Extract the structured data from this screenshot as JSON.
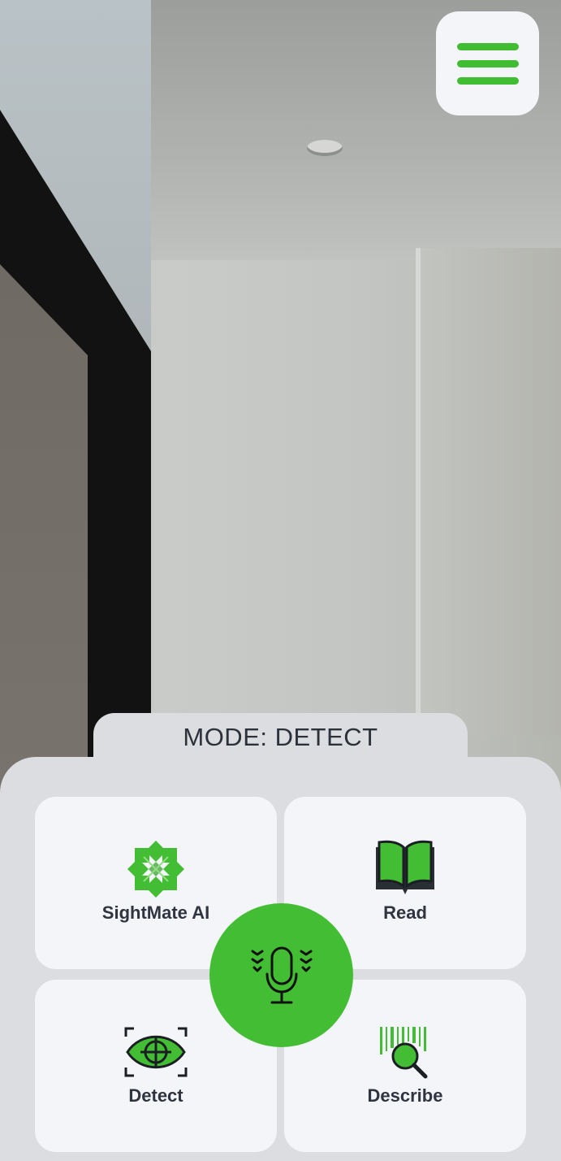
{
  "header": {
    "menu_icon": "hamburger-menu-icon",
    "accent_color": "#43bd33"
  },
  "mode": {
    "label": "MODE: DETECT"
  },
  "tiles": [
    {
      "label": "SightMate AI",
      "icon": "sightmate-logo-icon"
    },
    {
      "label": "Read",
      "icon": "open-book-icon"
    },
    {
      "label": "Detect",
      "icon": "eye-target-icon"
    },
    {
      "label": "Describe",
      "icon": "barcode-search-icon"
    }
  ],
  "mic": {
    "icon": "microphone-icon"
  },
  "colors": {
    "accent": "#43bd33",
    "tile_bg": "#f4f5f9",
    "panel_bg": "#dcdde0",
    "text": "#2f3440"
  }
}
